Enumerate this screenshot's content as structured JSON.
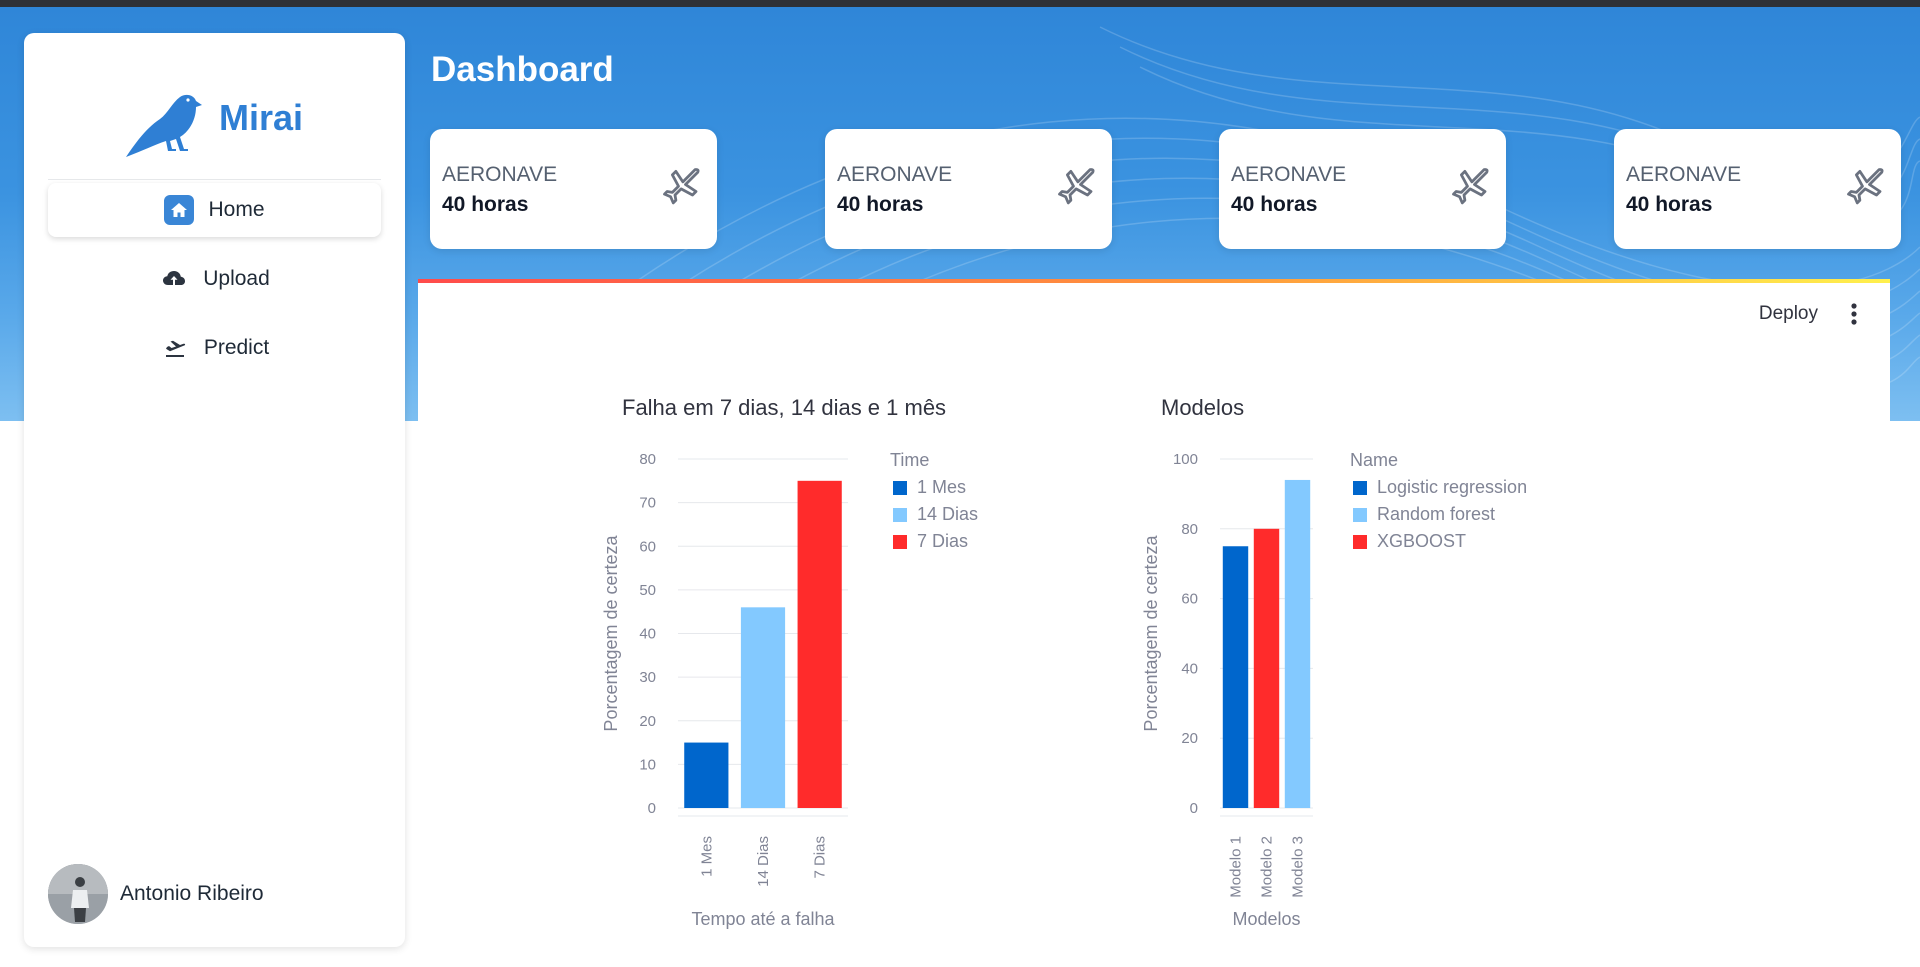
{
  "app": {
    "name": "Mirai",
    "page_title": "Dashboard"
  },
  "sidebar": {
    "items": [
      {
        "label": "Home",
        "icon": "home-icon",
        "active": true
      },
      {
        "label": "Upload",
        "icon": "cloud-upload-icon",
        "active": false
      },
      {
        "label": "Predict",
        "icon": "flight-takeoff-icon",
        "active": false
      }
    ],
    "user": {
      "name": "Antonio Ribeiro"
    }
  },
  "cards": [
    {
      "label": "AERONAVE",
      "value": "40 horas",
      "icon": "airplane-icon"
    },
    {
      "label": "AERONAVE",
      "value": "40 horas",
      "icon": "airplane-icon"
    },
    {
      "label": "AERONAVE",
      "value": "40 horas",
      "icon": "airplane-icon"
    },
    {
      "label": "AERONAVE",
      "value": "40 horas",
      "icon": "airplane-icon"
    }
  ],
  "toolbar": {
    "deploy_label": "Deploy"
  },
  "colors": {
    "accent": "#2f7fd4",
    "dark_blue": "#0066cc",
    "light_blue": "#83c9ff",
    "red": "#ff2b2b"
  },
  "chart_data": [
    {
      "type": "bar",
      "title": "Falha em 7 dias, 14 dias e 1 mês",
      "categories": [
        "1 Mes",
        "14 Dias",
        "7 Dias"
      ],
      "values": [
        15,
        46,
        75
      ],
      "colors": [
        "#0066cc",
        "#83c9ff",
        "#ff2b2b"
      ],
      "xlabel": "Tempo até a falha",
      "ylabel": "Porcentagem de certeza",
      "ylim": [
        0,
        80
      ],
      "yticks": [
        0,
        10,
        20,
        30,
        40,
        50,
        60,
        70,
        80
      ],
      "legend_title": "Time",
      "legend": [
        "1 Mes",
        "14 Dias",
        "7 Dias"
      ],
      "legend_position": "right",
      "grid": true
    },
    {
      "type": "bar",
      "title": "Modelos",
      "categories": [
        "Modelo 1",
        "Modelo 2",
        "Modelo 3"
      ],
      "values": [
        75,
        80,
        94
      ],
      "colors": [
        "#0066cc",
        "#ff2b2b",
        "#83c9ff"
      ],
      "xlabel": "Modelos",
      "ylabel": "Porcentagem de certeza",
      "ylim": [
        0,
        100
      ],
      "yticks": [
        0,
        20,
        40,
        60,
        80,
        100
      ],
      "legend_title": "Name",
      "legend": [
        "Logistic regression",
        "Random forest",
        "XGBOOST"
      ],
      "legend_colors": [
        "#0066cc",
        "#83c9ff",
        "#ff2b2b"
      ],
      "legend_position": "right",
      "grid": true
    }
  ]
}
